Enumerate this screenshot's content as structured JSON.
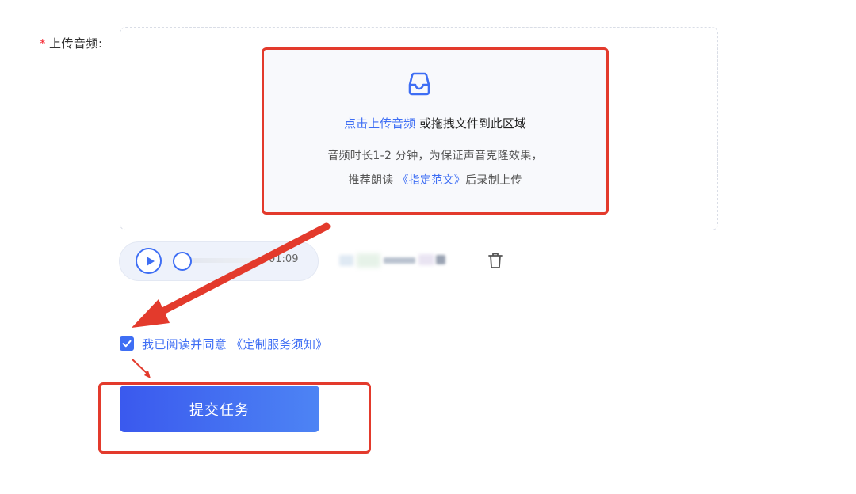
{
  "form": {
    "required_mark": "*",
    "label": "上传音频:"
  },
  "upload": {
    "icon": "inbox-icon",
    "title_link": "点击上传音频",
    "title_rest": " 或拖拽文件到此区域",
    "hint_line1": "音频时长1-2 分钟，为保证声音克隆效果，",
    "hint_line2_prefix": "推荐朗读 ",
    "hint_line2_link": "《指定范文》",
    "hint_line2_suffix": "后录制上传"
  },
  "player": {
    "play_icon": "play-icon",
    "time": "01:09",
    "delete_icon": "trash-icon"
  },
  "agreement": {
    "checked": true,
    "text": "我已阅读并同意 《定制服务须知》"
  },
  "submit": {
    "label": "提交任务"
  },
  "colors": {
    "accent": "#3e6ef4",
    "annotation": "#e33a2c"
  }
}
